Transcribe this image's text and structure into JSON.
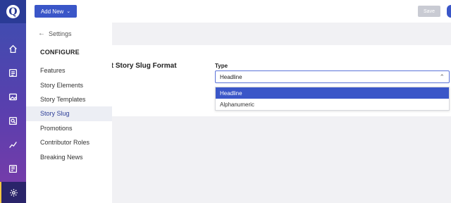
{
  "topbar": {
    "add_new_label": "Add New",
    "save_label": "Save"
  },
  "settings_panel": {
    "back_label": "Settings",
    "section_heading": "CONFIGURE",
    "items": [
      {
        "label": "Features",
        "active": false
      },
      {
        "label": "Story Elements",
        "active": false
      },
      {
        "label": "Story Templates",
        "active": false
      },
      {
        "label": "Story Slug",
        "active": true
      },
      {
        "label": "Promotions",
        "active": false
      },
      {
        "label": "Contributor Roles",
        "active": false
      },
      {
        "label": "Breaking News",
        "active": false
      }
    ]
  },
  "main": {
    "section_title": "lt Story Slug Format",
    "type_label": "Type",
    "type_value": "Headline",
    "dropdown_options": [
      {
        "label": "Headline",
        "selected": true
      },
      {
        "label": "Alphanumeric",
        "selected": false
      }
    ]
  },
  "rail_icons": [
    "home-icon",
    "stories-icon",
    "media-icon",
    "search-icon",
    "analytics-icon",
    "pages-icon",
    "settings-icon"
  ],
  "colors": {
    "accent": "#3a56c8",
    "rail_top": "#3b4fb0",
    "rail_bottom": "#7b3ba8",
    "active_marker": "#f4c542"
  }
}
